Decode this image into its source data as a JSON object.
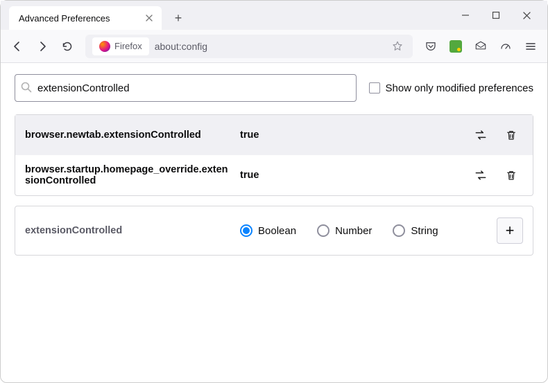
{
  "window": {
    "tab_title": "Advanced Preferences"
  },
  "toolbar": {
    "identity_label": "Firefox",
    "url": "about:config"
  },
  "search": {
    "value": "extensionControlled",
    "checkbox_label": "Show only modified preferences"
  },
  "prefs": [
    {
      "name": "browser.newtab.extensionControlled",
      "value": "true"
    },
    {
      "name": "browser.startup.homepage_override.extensionControlled",
      "value": "true"
    }
  ],
  "create": {
    "name": "extensionControlled",
    "types": [
      "Boolean",
      "Number",
      "String"
    ],
    "selected": "Boolean"
  }
}
